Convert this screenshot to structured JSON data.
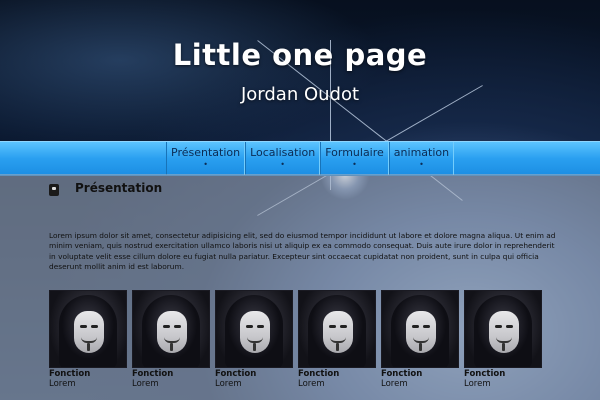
{
  "header": {
    "title": "Little one page",
    "subtitle": "Jordan Oudot"
  },
  "nav": {
    "items": [
      {
        "label": "Présentation",
        "dot": "•"
      },
      {
        "label": "Localisation",
        "dot": "•"
      },
      {
        "label": "Formulaire",
        "dot": "•"
      },
      {
        "label": "animation",
        "dot": "•"
      }
    ]
  },
  "section": {
    "icon": "user-card-icon",
    "title": "Présentation",
    "body": "Lorem ipsum dolor sit amet, consectetur adipisicing elit, sed do eiusmod tempor incididunt ut labore et dolore magna aliqua. Ut enim ad minim veniam, quis nostrud exercitation ullamco laboris nisi ut aliquip ex ea commodo consequat. Duis aute irure dolor in reprehenderit in voluptate velit esse cillum dolore eu fugiat nulla pariatur. Excepteur sint occaecat cupidatat non proident, sunt in culpa qui officia deserunt mollit anim id est laborum."
  },
  "cards": [
    {
      "title": "Fonction",
      "sub": "Lorem",
      "image": "masked-person-image"
    },
    {
      "title": "Fonction",
      "sub": "Lorem",
      "image": "masked-person-image"
    },
    {
      "title": "Fonction",
      "sub": "Lorem",
      "image": "masked-person-image"
    },
    {
      "title": "Fonction",
      "sub": "Lorem",
      "image": "masked-person-image"
    },
    {
      "title": "Fonction",
      "sub": "Lorem",
      "image": "masked-person-image"
    },
    {
      "title": "Fonction",
      "sub": "Lorem",
      "image": "masked-person-image"
    }
  ],
  "colors": {
    "nav_bar": "#2a9ff0",
    "nav_text": "#0b2c55",
    "title_text": "#ffffff"
  }
}
